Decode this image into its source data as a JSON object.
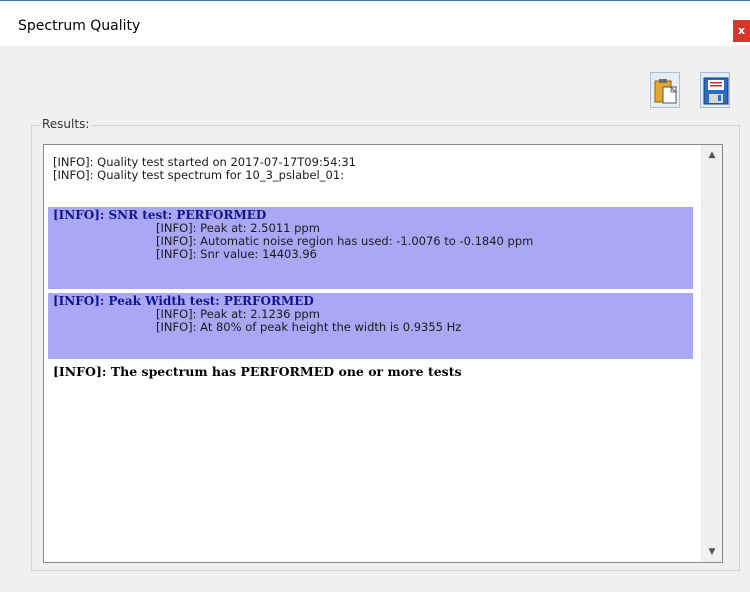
{
  "window": {
    "title": "Spectrum Quality",
    "close_label": "x"
  },
  "toolbar": {
    "paste_icon": "clipboard-paste-icon",
    "save_icon": "floppy-save-icon"
  },
  "results": {
    "group_label": "Results:",
    "header_lines": [
      "[INFO]: Quality test started on 2017-07-17T09:54:31",
      "[INFO]: Quality test spectrum for 10_3_pslabel_01:"
    ],
    "snr": {
      "heading": "[INFO]: SNR test: PERFORMED",
      "lines": [
        "[INFO]: Peak at: 2.5011 ppm",
        "[INFO]: Automatic noise region has used: -1.0076 to -0.1840 ppm",
        "[INFO]: Snr value: 14403.96"
      ]
    },
    "peak_width": {
      "heading": "[INFO]: Peak Width test: PERFORMED",
      "lines": [
        "[INFO]: Peak at: 2.1236 ppm",
        "[INFO]: At 80% of peak height the width is 0.9355 Hz"
      ]
    },
    "summary": "[INFO]: The spectrum has PERFORMED one or more tests"
  },
  "colors": {
    "highlight": "#a8a8f4",
    "heading_text": "#14148a",
    "close_button": "#d9352b"
  }
}
